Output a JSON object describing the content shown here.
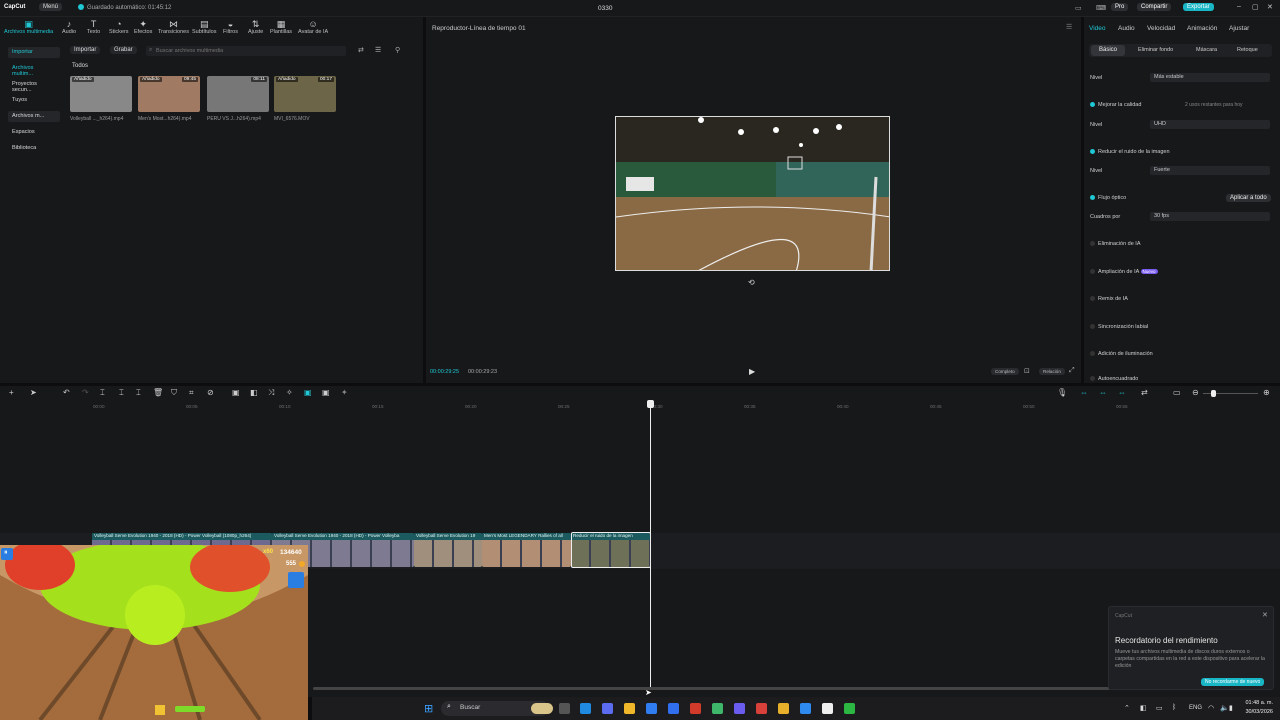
{
  "app": {
    "logo": "CapCut",
    "menu_label": "Menú",
    "autosave": "Guardado automático: 01:45:12",
    "project_name": "0330",
    "pro_label": "Pro",
    "share_label": "Compartir",
    "export_label": "Exportar"
  },
  "toolbar": {
    "items": [
      "Archivos multimedia",
      "Audio",
      "Texto",
      "Stickers",
      "Efectos",
      "Transiciones",
      "Subtítulos",
      "Filtros",
      "Ajuste",
      "Plantillas",
      "Avatar de IA"
    ]
  },
  "media": {
    "sidebar": [
      "Importar",
      "Archivos multim...",
      "Proyectos secun...",
      "Tuyos",
      "Archivos m...",
      "Espacios",
      "Biblioteca"
    ],
    "import_button": "Importar",
    "record_button": "Grabar",
    "search_placeholder": "Buscar archivos multimedia",
    "filter_all": "Todos",
    "items": [
      {
        "name": "Volleyball ..._h264).mp4",
        "badge": "Añadido",
        "duration": "",
        "color": "#888"
      },
      {
        "name": "Men's Most...h264).mp4",
        "badge": "Añadido",
        "duration": "09:45",
        "color": "#a07a62"
      },
      {
        "name": "PERU VS J...h264).mp4",
        "badge": "",
        "duration": "08:11",
        "color": "#777"
      },
      {
        "name": "MVI_6576.MOV",
        "badge": "Añadido",
        "duration": "00:17",
        "color": "#6c6548"
      }
    ]
  },
  "player": {
    "title": "Reproductor-Línea de tiempo 01",
    "current_time": "00:00:29:25",
    "total_time": "00:00:29:23",
    "ratio_label": "Completo",
    "quality_label": "Relación"
  },
  "props": {
    "tabs": [
      "Video",
      "Audio",
      "Velocidad",
      "Animación",
      "Ajustar"
    ],
    "subtabs": [
      "Básico",
      "Eliminar fondo",
      "Máscara",
      "Retoque"
    ],
    "nivel_label": "Nivel",
    "nivel_value": "Más estable",
    "improve_quality": "Mejorar la calidad",
    "uses_left": "2 usos restantes para hoy",
    "quality_value": "UHD",
    "noise_label": "Reducir el ruido de la imagen",
    "noise_value": "Fuerte",
    "optical_flow": "Flujo óptico",
    "apply_all": "Aplicar a todo",
    "fps_label": "Cuadros por",
    "fps_value": "30 fps",
    "ai_items": [
      "Eliminación de IA",
      "Ampliación de IA",
      "Remix de IA",
      "Sincronización labial",
      "Adición de iluminación",
      "Autoencuadrado"
    ],
    "new_badge": "Nuevo"
  },
  "timeline": {
    "ticks": [
      "00:00",
      "00:05",
      "00:10",
      "00:15",
      "00:20",
      "00:25",
      "00:30",
      "00:35",
      "00:40",
      "00:45",
      "00:50",
      "00:55"
    ],
    "clips": [
      {
        "label": "Volleyball Serve Evolution 1940 - 2018 (HD) - Power Volleyball (1080p_h264)",
        "color": "#6e6a8f"
      },
      {
        "label": "Volleyball Serve Evolution 1940 - 2018 (HD) - Power Volleyba",
        "color": "#7e7a92"
      },
      {
        "label": "Volleyball Serve Evolution 19",
        "color": "#a08f7d"
      },
      {
        "label": "Men's Most LEGENDARY Rallies of all",
        "color": "#b28e74"
      },
      {
        "label": "Reducir el ruido de la imagen",
        "color": "#6e7058"
      }
    ]
  },
  "game": {
    "multiplier": "x60",
    "score": "134640",
    "coins": "555"
  },
  "notification": {
    "app": "CapCut",
    "title": "Recordatorio del rendimiento",
    "body": "Mueve tus archivos multimedia de discos duros externos o carpetas compartidas en la red a este dispositivo para acelerar la edición",
    "action": "No recordarme de nuevo"
  },
  "taskbar": {
    "search_label": "Buscar",
    "lang": "ENG",
    "time": "01:48 a. m.",
    "date": "30/03/2026"
  }
}
